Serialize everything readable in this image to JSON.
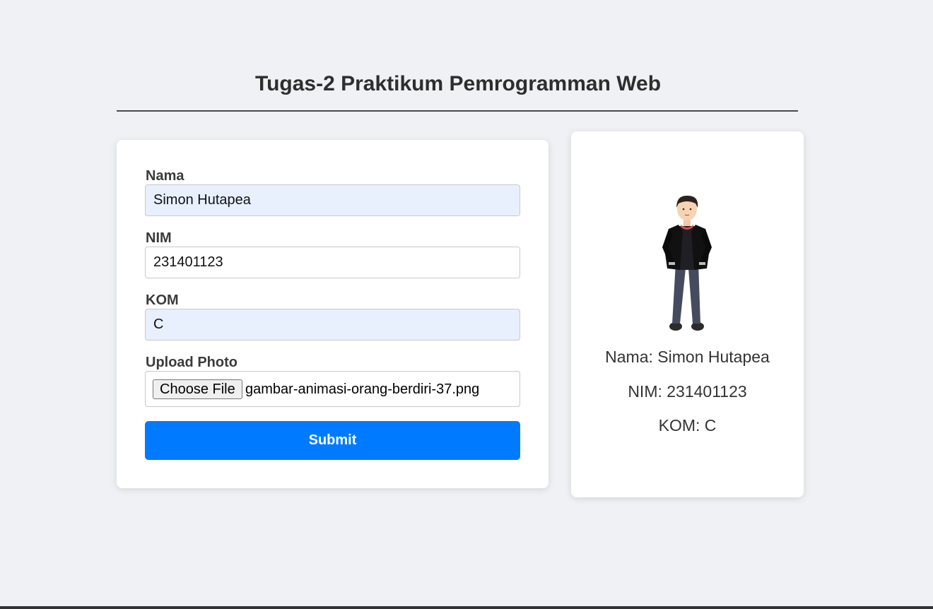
{
  "header": {
    "title": "Tugas-2 Praktikum Pemrogramman Web"
  },
  "form": {
    "nama_label": "Nama",
    "nama_value": "Simon Hutapea",
    "nim_label": "NIM",
    "nim_value": "231401123",
    "kom_label": "KOM",
    "kom_value": "C",
    "photo_label": "Upload Photo",
    "choose_file_label": "Choose File",
    "file_name": "gambar-animasi-orang-berdiri-37.png",
    "submit_label": "Submit"
  },
  "profile": {
    "avatar_icon": "standing-person-illustration",
    "nama_line": "Nama: Simon Hutapea",
    "nim_line": "NIM: 231401123",
    "kom_line": "KOM: C"
  },
  "colors": {
    "background": "#f0f1f5",
    "card": "#ffffff",
    "submit": "#007bff",
    "autofill": "#e8f0fe"
  }
}
